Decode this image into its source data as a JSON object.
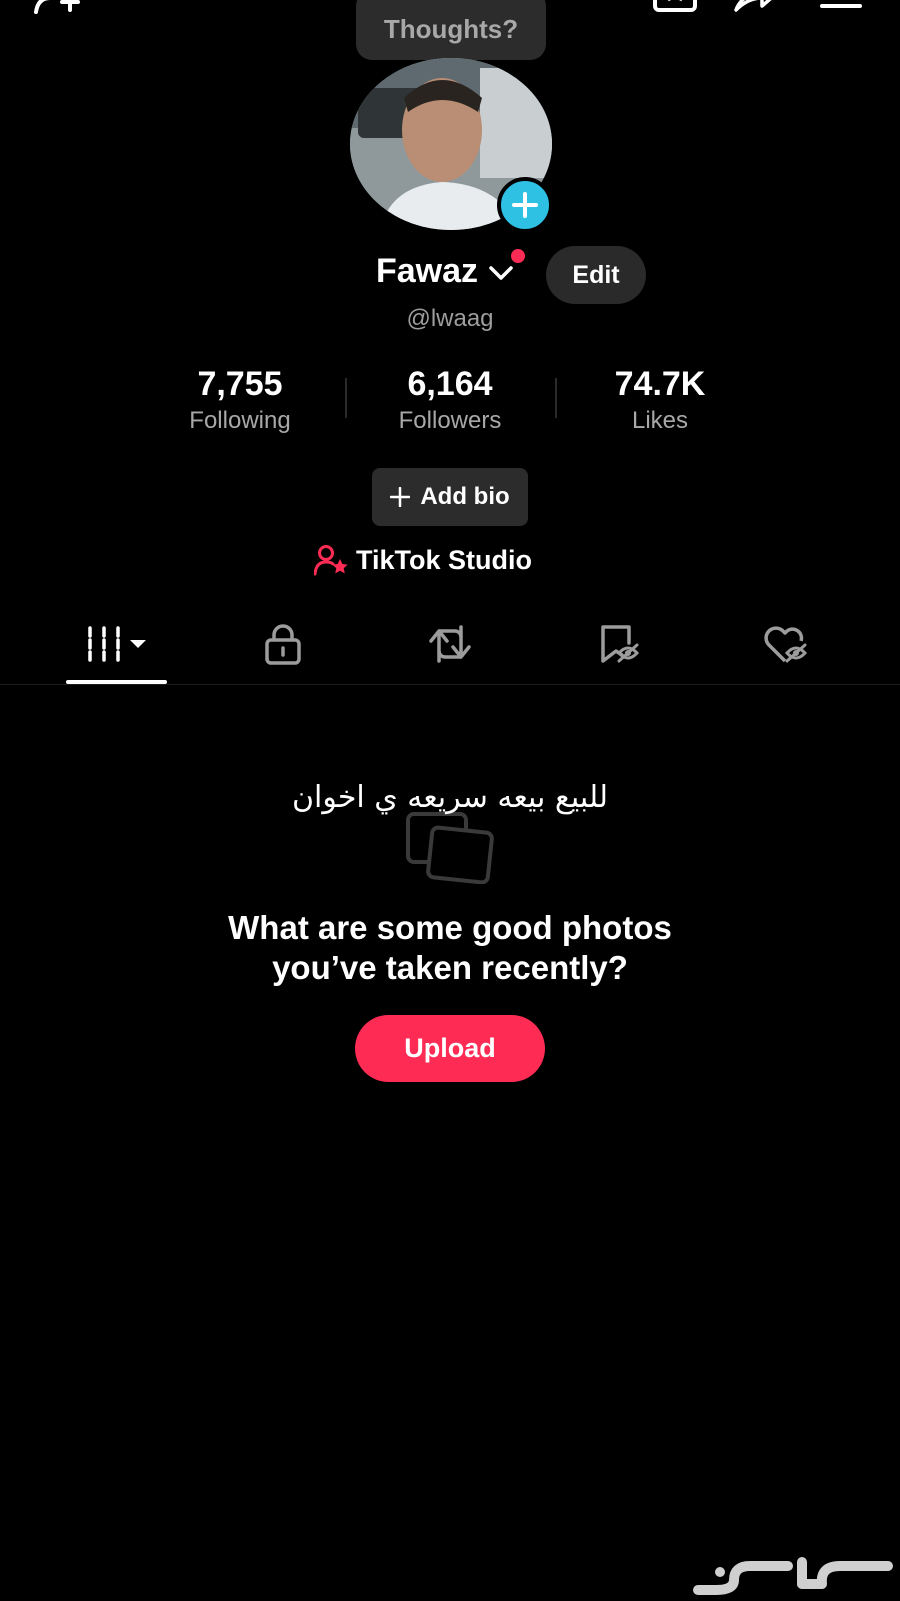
{
  "header": {
    "thoughts_label": "Thoughts?"
  },
  "profile": {
    "display_name": "Fawaz",
    "edit_label": "Edit",
    "handle": "@lwaag"
  },
  "stats": [
    {
      "value": "7,755",
      "label": "Following"
    },
    {
      "value": "6,164",
      "label": "Followers"
    },
    {
      "value": "74.7K",
      "label": "Likes"
    }
  ],
  "add_bio_label": "Add bio",
  "studio_label": "TikTok Studio",
  "tabs": [
    {
      "icon": "videos-grid-icon",
      "selected": true
    },
    {
      "icon": "lock-icon",
      "selected": false
    },
    {
      "icon": "repost-icon",
      "selected": false
    },
    {
      "icon": "favorites-icon",
      "selected": false
    },
    {
      "icon": "liked-icon",
      "selected": false
    }
  ],
  "overlay_text": "للبيع بيعه سريعه ي اخوان",
  "empty_state": {
    "line1": "What are some good photos",
    "line2": "you’ve taken recently?",
    "upload_label": "Upload"
  },
  "colors": {
    "background": "#000000",
    "accent": "#fe2c55",
    "add_badge": "#2fc1e4",
    "chip": "#2c2c2c"
  }
}
